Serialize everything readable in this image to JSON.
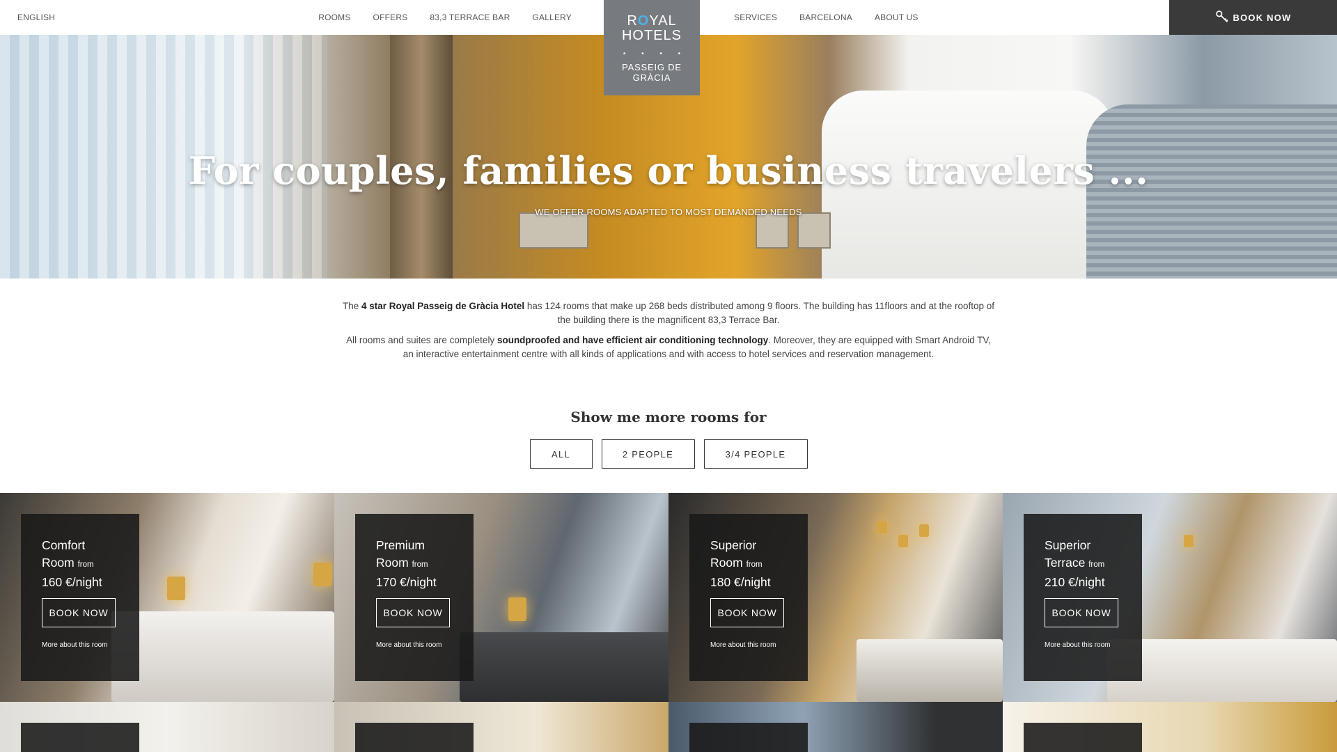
{
  "header": {
    "language": "ENGLISH",
    "nav_left": [
      "ROOMS",
      "OFFERS",
      "83,3 TERRACE BAR",
      "GALLERY"
    ],
    "nav_right": [
      "SERVICES",
      "BARCELONA",
      "ABOUT US"
    ],
    "book_now": "BOOK NOW",
    "book_icon": "key-icon"
  },
  "logo": {
    "line1_pre": "R",
    "line1_o": "O",
    "line1_post": "YAL",
    "line2": "HOTELS",
    "stars": "• • • •",
    "sub1": "PASSEIG DE",
    "sub2": "GRÀCIA"
  },
  "hero": {
    "title": "For couples, families or business travelers ...",
    "subtitle": "WE OFFER ROOMS ADAPTED TO MOST DEMANDED NEEDS"
  },
  "intro": {
    "p1_a": "The ",
    "p1_b": "4 star Royal Passeig de Gràcia Hotel",
    "p1_c": " has 124 rooms that make up 268 beds distributed among 9 floors. The building has 11floors and at the rooftop of the building there is the magnificent 83,3 Terrace Bar.",
    "p2_a": "All rooms and suites are completely ",
    "p2_b": "soundproofed and have efficient air conditioning technology",
    "p2_c": ". Moreover, they are equipped with Smart Android TV, an interactive entertainment centre with all kinds of applications and with access to hotel services and reservation management."
  },
  "filter": {
    "title": "Show me more rooms for",
    "options": [
      "ALL",
      "2 PEOPLE",
      "3/4 PEOPLE"
    ]
  },
  "rooms": [
    {
      "line1": "Comfort",
      "line2": "Room",
      "from": "from",
      "price": "160 €/night",
      "book": "BOOK NOW",
      "more": "More about this room"
    },
    {
      "line1": "Premium",
      "line2": "Room",
      "from": "from",
      "price": "170 €/night",
      "book": "BOOK NOW",
      "more": "More about this room"
    },
    {
      "line1": "Superior",
      "line2": "Room",
      "from": "from",
      "price": "180 €/night",
      "book": "BOOK NOW",
      "more": "More about this room"
    },
    {
      "line1": "Superior",
      "line2": "Terrace",
      "from": "from",
      "price": "210 €/night",
      "book": "BOOK NOW",
      "more": "More about this room"
    }
  ],
  "colors": {
    "book_bar": "#3a3a3a",
    "logo_bg": "#777b7f",
    "logo_accent": "#4ab3e6",
    "card_bg": "#191919"
  }
}
